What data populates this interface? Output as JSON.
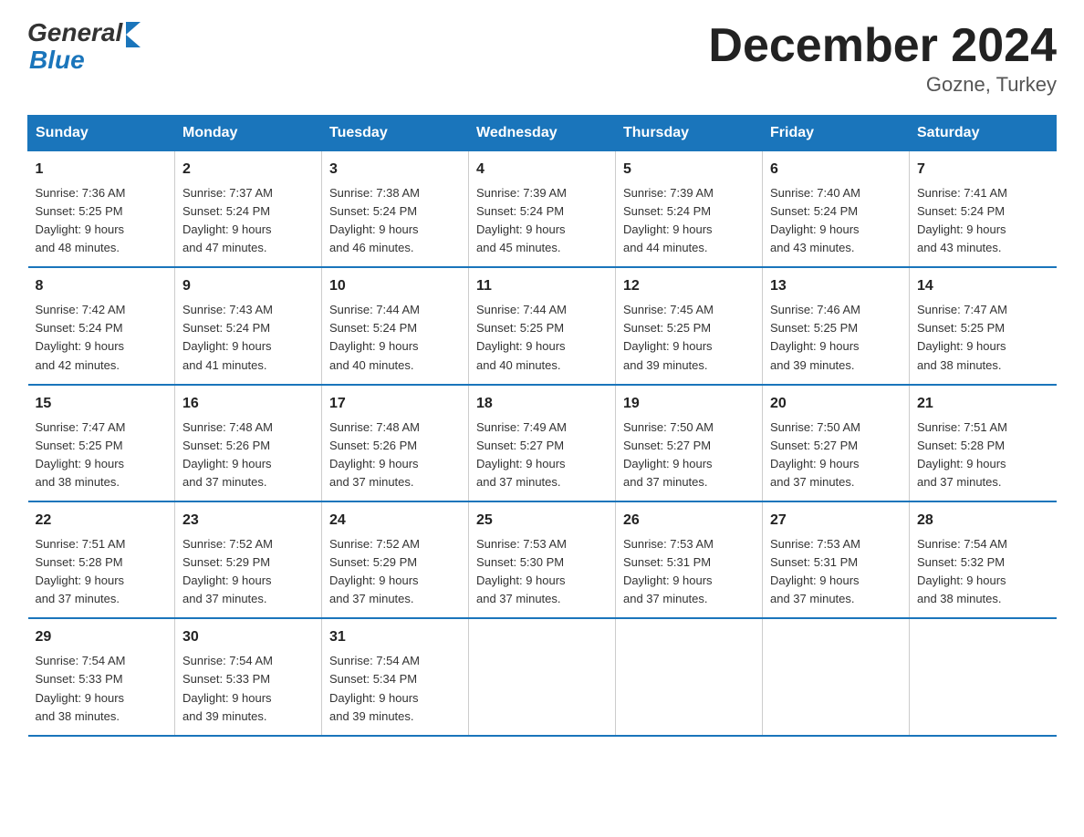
{
  "header": {
    "title": "December 2024",
    "location": "Gozne, Turkey"
  },
  "logo": {
    "general": "General",
    "blue": "Blue"
  },
  "columns": [
    "Sunday",
    "Monday",
    "Tuesday",
    "Wednesday",
    "Thursday",
    "Friday",
    "Saturday"
  ],
  "weeks": [
    [
      {
        "day": "1",
        "sunrise": "7:36 AM",
        "sunset": "5:25 PM",
        "daylight": "9 hours and 48 minutes."
      },
      {
        "day": "2",
        "sunrise": "7:37 AM",
        "sunset": "5:24 PM",
        "daylight": "9 hours and 47 minutes."
      },
      {
        "day": "3",
        "sunrise": "7:38 AM",
        "sunset": "5:24 PM",
        "daylight": "9 hours and 46 minutes."
      },
      {
        "day": "4",
        "sunrise": "7:39 AM",
        "sunset": "5:24 PM",
        "daylight": "9 hours and 45 minutes."
      },
      {
        "day": "5",
        "sunrise": "7:39 AM",
        "sunset": "5:24 PM",
        "daylight": "9 hours and 44 minutes."
      },
      {
        "day": "6",
        "sunrise": "7:40 AM",
        "sunset": "5:24 PM",
        "daylight": "9 hours and 43 minutes."
      },
      {
        "day": "7",
        "sunrise": "7:41 AM",
        "sunset": "5:24 PM",
        "daylight": "9 hours and 43 minutes."
      }
    ],
    [
      {
        "day": "8",
        "sunrise": "7:42 AM",
        "sunset": "5:24 PM",
        "daylight": "9 hours and 42 minutes."
      },
      {
        "day": "9",
        "sunrise": "7:43 AM",
        "sunset": "5:24 PM",
        "daylight": "9 hours and 41 minutes."
      },
      {
        "day": "10",
        "sunrise": "7:44 AM",
        "sunset": "5:24 PM",
        "daylight": "9 hours and 40 minutes."
      },
      {
        "day": "11",
        "sunrise": "7:44 AM",
        "sunset": "5:25 PM",
        "daylight": "9 hours and 40 minutes."
      },
      {
        "day": "12",
        "sunrise": "7:45 AM",
        "sunset": "5:25 PM",
        "daylight": "9 hours and 39 minutes."
      },
      {
        "day": "13",
        "sunrise": "7:46 AM",
        "sunset": "5:25 PM",
        "daylight": "9 hours and 39 minutes."
      },
      {
        "day": "14",
        "sunrise": "7:47 AM",
        "sunset": "5:25 PM",
        "daylight": "9 hours and 38 minutes."
      }
    ],
    [
      {
        "day": "15",
        "sunrise": "7:47 AM",
        "sunset": "5:25 PM",
        "daylight": "9 hours and 38 minutes."
      },
      {
        "day": "16",
        "sunrise": "7:48 AM",
        "sunset": "5:26 PM",
        "daylight": "9 hours and 37 minutes."
      },
      {
        "day": "17",
        "sunrise": "7:48 AM",
        "sunset": "5:26 PM",
        "daylight": "9 hours and 37 minutes."
      },
      {
        "day": "18",
        "sunrise": "7:49 AM",
        "sunset": "5:27 PM",
        "daylight": "9 hours and 37 minutes."
      },
      {
        "day": "19",
        "sunrise": "7:50 AM",
        "sunset": "5:27 PM",
        "daylight": "9 hours and 37 minutes."
      },
      {
        "day": "20",
        "sunrise": "7:50 AM",
        "sunset": "5:27 PM",
        "daylight": "9 hours and 37 minutes."
      },
      {
        "day": "21",
        "sunrise": "7:51 AM",
        "sunset": "5:28 PM",
        "daylight": "9 hours and 37 minutes."
      }
    ],
    [
      {
        "day": "22",
        "sunrise": "7:51 AM",
        "sunset": "5:28 PM",
        "daylight": "9 hours and 37 minutes."
      },
      {
        "day": "23",
        "sunrise": "7:52 AM",
        "sunset": "5:29 PM",
        "daylight": "9 hours and 37 minutes."
      },
      {
        "day": "24",
        "sunrise": "7:52 AM",
        "sunset": "5:29 PM",
        "daylight": "9 hours and 37 minutes."
      },
      {
        "day": "25",
        "sunrise": "7:53 AM",
        "sunset": "5:30 PM",
        "daylight": "9 hours and 37 minutes."
      },
      {
        "day": "26",
        "sunrise": "7:53 AM",
        "sunset": "5:31 PM",
        "daylight": "9 hours and 37 minutes."
      },
      {
        "day": "27",
        "sunrise": "7:53 AM",
        "sunset": "5:31 PM",
        "daylight": "9 hours and 37 minutes."
      },
      {
        "day": "28",
        "sunrise": "7:54 AM",
        "sunset": "5:32 PM",
        "daylight": "9 hours and 38 minutes."
      }
    ],
    [
      {
        "day": "29",
        "sunrise": "7:54 AM",
        "sunset": "5:33 PM",
        "daylight": "9 hours and 38 minutes."
      },
      {
        "day": "30",
        "sunrise": "7:54 AM",
        "sunset": "5:33 PM",
        "daylight": "9 hours and 39 minutes."
      },
      {
        "day": "31",
        "sunrise": "7:54 AM",
        "sunset": "5:34 PM",
        "daylight": "9 hours and 39 minutes."
      },
      null,
      null,
      null,
      null
    ]
  ]
}
